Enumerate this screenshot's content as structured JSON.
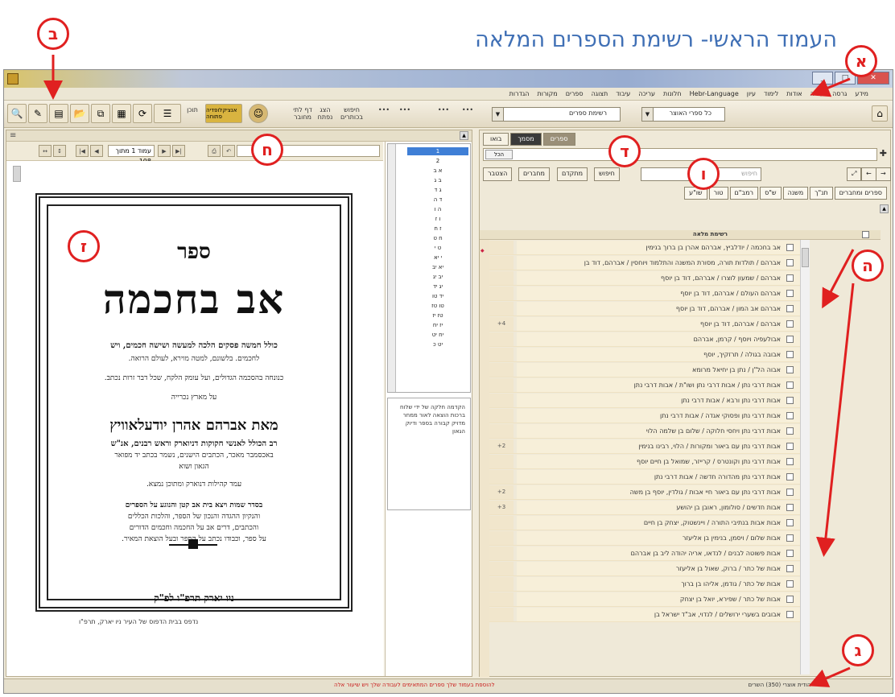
{
  "doc_title": "העמוד הראשי- רשימת הספרים המלאה",
  "badges": {
    "aleph": "א",
    "bet": "ב",
    "gimel": "ג",
    "dalet": "ד",
    "he": "ה",
    "vav": "ו",
    "zayin": "ז",
    "chet": "ח"
  },
  "menu": [
    "מידע",
    "גרסה",
    "עזרה",
    "אודות",
    "לימוד",
    "עיון",
    "Hebr-Language",
    "חלונות",
    "עריכה",
    "עיבוד",
    "תצוגה",
    "ספרים",
    "מקורות",
    "הגדרות"
  ],
  "toolbar": {
    "library_combo": "כל ספרי האוצר",
    "list_combo": "רשימת ספרים",
    "encyclopedia_button": "אנציקלופדיה פתוחה",
    "toc_label": "תוכן",
    "nav_labels": [
      "חיפוש בכותרים",
      "הצג נפתח",
      "דף לתי מחובר"
    ]
  },
  "left_pane": {
    "page_input": "עמוד 1 מתוך 108",
    "toc_items": [
      "1",
      "2",
      "א ב",
      "ב ג",
      "ג ד",
      "ד ה",
      "ה ו",
      "ו ז",
      "ז ח",
      "ח ט",
      "ט י",
      "י יא",
      "יא יב",
      "יב יג",
      "יג יד",
      "יד טו",
      "טו טז",
      "טז יז",
      "יז יח",
      "יח יט",
      "יט כ"
    ],
    "toc_description": "הקדמה חלקה של ידי שלוח ברכות הוצאה לאור ממחר מדויק קבורה בספר ודיוק הגאון",
    "book_page": {
      "title_small": "ספר",
      "title_large": "אב בחכמה",
      "line1": "כולל חמשה פסקים הלכה למעשה ושישה חכמים, ויש",
      "line2": "לחכמים. בלשונם, למטה מוירא, לעולם הרואה.",
      "line3": "כנונחה בהסכמה הגדולים, ועל עומק הלקח, שכל דבר זרות נכתב.",
      "line4": "על מארץ נכרייה",
      "author": "מאת אברהם אהרן יודעלאוויץ",
      "line5": "רב הכולל לאנשי חקוקות דניוארק וראש רבנים, אנ\"ש",
      "line6": "באכסמבר מאכר, הכתבים הישנים, נשמר בכתב יד מפואר",
      "line7": "הגאון ושוא",
      "line8": "עמד קהילות דנוארק ומתוכן נמצא.",
      "line9": "בסדר שמות ויצא בית אב קטן והנוגע על הספרים",
      "line10": "והנקיון ההגדה והנכון של הספר, והלכות הכללים",
      "line11": "והכתבים, דרים אב על החכמה וחכמים הדורים",
      "line12": "על ספר, וכבודו נכתב על הספר ובעל הוצאת המאיר.",
      "footer": "ניו יארק תרפ\"ו לפ\"ק",
      "below": "נדפס בבית הדפוס של העיר ניו יארק, תרפ\"ו"
    }
  },
  "right_pane": {
    "tabs": [
      "בואו",
      "מסמך",
      "ספרים"
    ],
    "filter_select": "הכל",
    "search_placeholder": "חיפוש",
    "search_buttons": [
      "הצטבר",
      "מחברים",
      "מחברים",
      "חיפוש",
      "מתקדם"
    ],
    "filter_buttons": [
      "ספרים ומחברים",
      "תנ\"ך",
      "משנה",
      "ש\"ס",
      "רמב\"ם",
      "טור",
      "שו\"ע"
    ],
    "list_header": "רשימת מלאה",
    "rows": [
      {
        "count": "",
        "text": "אב בחכמה / יודלביץ, אברהם אהרן בן ברוך בנימין"
      },
      {
        "count": "",
        "text": "אברהם / תולדות תורה, מסורת המשנה והתלמוד ויוחסין / אברהם, דוד בן"
      },
      {
        "count": "",
        "text": "אברהם / שמעון לוצרו / אברהם, דוד בן יוסף"
      },
      {
        "count": "",
        "text": "אברהם העולם / אברהם, דוד בן יוסף"
      },
      {
        "count": "",
        "text": "אברהם אב המון / אברהם, דוד בן יוסף"
      },
      {
        "count": "+4",
        "text": "אברהם / אברהם, דוד בן יוסף"
      },
      {
        "count": "",
        "text": "אבולעפיה ויוסף / קרמן, אברהם"
      },
      {
        "count": "",
        "text": "אבובה בגולה / תרזקיך, יוסף"
      },
      {
        "count": "",
        "text": "אבוה הל\"ן / נתן בן יחיאל מרומא"
      },
      {
        "count": "",
        "text": "אבות דרבי נתן / אבות דרבי נתן ושו\"ת / אבות דרבי נתן"
      },
      {
        "count": "",
        "text": "אבות דרבי נתן ורבא / אבות דרבי נתן"
      },
      {
        "count": "",
        "text": "אבות דרבי נתן ופסוקי אגדה / אבות דרבי נתן"
      },
      {
        "count": "",
        "text": "אבות דרבי נתן ויחסי חלוקה / שלום בן שלמה הלוי"
      },
      {
        "count": "+2",
        "text": "אבות דרבי נתן עם ביאור ומקורות / הלוי, רבינו בנימין"
      },
      {
        "count": "",
        "text": "אבות דרבי נתן וקונטרס / קרייזר, שמואל בן חיים יוסף"
      },
      {
        "count": "",
        "text": "אבות דרבי נתן מהדורה חדשה / אבות דרבי נתן"
      },
      {
        "count": "+2",
        "text": "אבות דרבי נתן עם ביאור חיי אבות / גולדין, יוסף בן משה"
      },
      {
        "count": "+3",
        "text": "אבות חדשים / סולומון, ראובן בן יהושע"
      },
      {
        "count": "",
        "text": "אבות אבות בנתיבי התורה / ויינשטוק, יצחק בן חיים"
      },
      {
        "count": "",
        "text": "אבות שלום / ויסמן, בנימין בן אליעזר"
      },
      {
        "count": "",
        "text": "אבות פשוטה לבנים / לנדאו, אריה יהודה ליב בן אברהם"
      },
      {
        "count": "",
        "text": "אבות של כתר / ברוק, שאול בן אליעזר"
      },
      {
        "count": "",
        "text": "אבות של כתר / גודמן, אליהו בן ברוך"
      },
      {
        "count": "",
        "text": "אבות של כתר / שפירא, יואל בן יצחק"
      },
      {
        "count": "",
        "text": "אבובים בשערי ירושלים / לנדוי, אב\"ד ישראל בן"
      }
    ]
  },
  "statusbar": {
    "message": "להוספת בעמוד שלך ספרים המתאימים לעבודה שלך ויש שיעור אלה",
    "right_text": "יהודית אוצרי (350) השרים"
  }
}
